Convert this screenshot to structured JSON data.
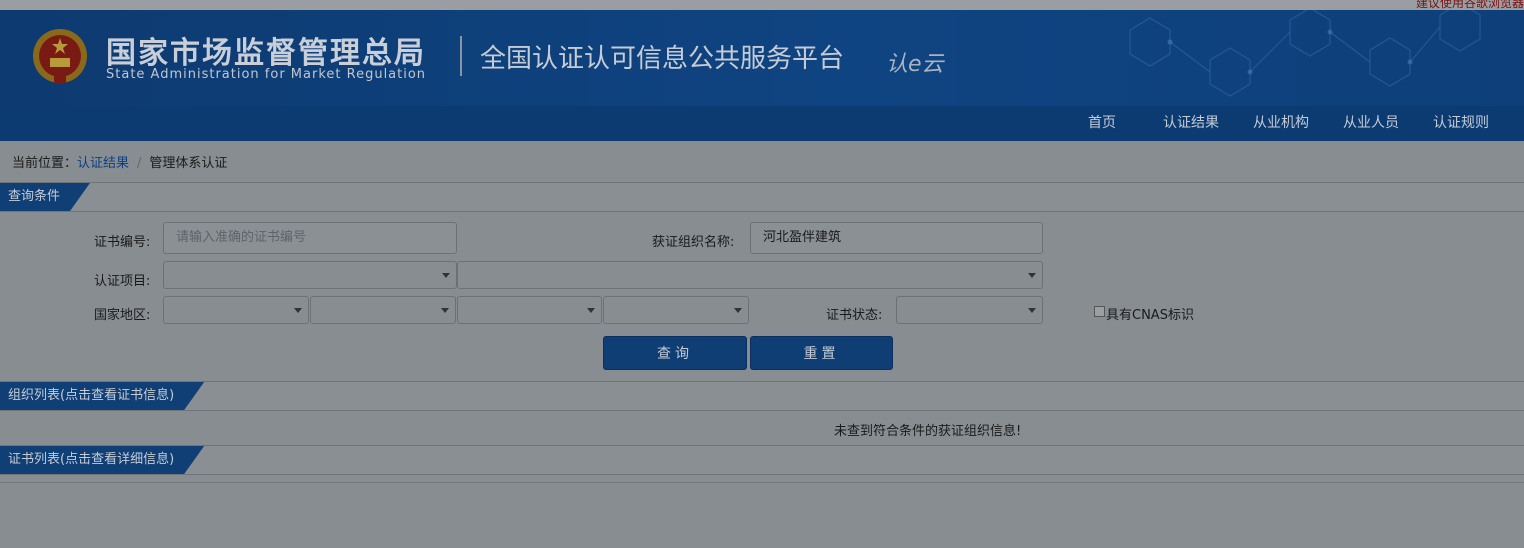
{
  "top_notice": "建议使用谷歌浏览器",
  "header": {
    "org_name_cn": "国家市场监督管理总局",
    "org_name_en": "State Administration  for  Market Regulation",
    "platform_name": "全国认证认可信息公共服务平台",
    "logo_text": "认e云"
  },
  "nav": {
    "items": [
      {
        "label": "首页"
      },
      {
        "label": "认证结果"
      },
      {
        "label": "从业机构"
      },
      {
        "label": "从业人员"
      },
      {
        "label": "认证规则"
      }
    ]
  },
  "breadcrumb": {
    "prefix": "当前位置：",
    "link": "认证结果",
    "separator": "/",
    "current": "管理体系认证"
  },
  "query": {
    "section_title": "查询条件",
    "cert_no_label": "证书编号:",
    "cert_no_placeholder": "请输入准确的证书编号",
    "org_name_label": "获证组织名称:",
    "org_name_value": "河北盈伴建筑",
    "project_label": "认证项目:",
    "region_label": "国家地区:",
    "status_label": "证书状态:",
    "cnas_label": "具有CNAS标识",
    "search_label": "查询",
    "reset_label": "重置"
  },
  "org_list": {
    "section_title": "组织列表(点击查看证书信息)",
    "empty_message": "未查到符合条件的获证组织信息!"
  },
  "cert_list": {
    "section_title": "证书列表(点击查看详细信息)"
  },
  "colors": {
    "overlay_gray": "#888d92",
    "banner_blue": "#0f4482",
    "button_blue": "#0f3e74"
  }
}
